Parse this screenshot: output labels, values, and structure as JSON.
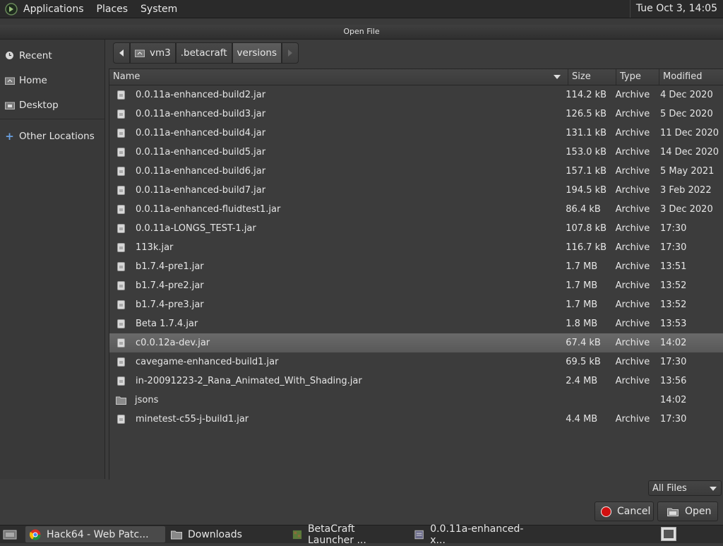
{
  "top_panel": {
    "menus": [
      "Applications",
      "Places",
      "System"
    ],
    "clock": "Tue Oct  3, 14:05"
  },
  "dialog": {
    "title": "Open File",
    "sidebar": {
      "items": [
        "Recent",
        "Home",
        "Desktop"
      ],
      "other": "Other Locations"
    },
    "pathbar": [
      "vm3",
      ".betacraft",
      "versions"
    ],
    "columns": {
      "name": "Name",
      "size": "Size",
      "type": "Type",
      "modified": "Modified"
    },
    "files": [
      {
        "name": "0.0.11a-enhanced-build2.jar",
        "size": "114.2 kB",
        "type": "Archive",
        "modified": "4 Dec 2020"
      },
      {
        "name": "0.0.11a-enhanced-build3.jar",
        "size": "126.5 kB",
        "type": "Archive",
        "modified": "5 Dec 2020"
      },
      {
        "name": "0.0.11a-enhanced-build4.jar",
        "size": "131.1 kB",
        "type": "Archive",
        "modified": "11 Dec 2020"
      },
      {
        "name": "0.0.11a-enhanced-build5.jar",
        "size": "153.0 kB",
        "type": "Archive",
        "modified": "14 Dec 2020"
      },
      {
        "name": "0.0.11a-enhanced-build6.jar",
        "size": "157.1 kB",
        "type": "Archive",
        "modified": "5 May 2021"
      },
      {
        "name": "0.0.11a-enhanced-build7.jar",
        "size": "194.5 kB",
        "type": "Archive",
        "modified": "3 Feb 2022"
      },
      {
        "name": "0.0.11a-enhanced-fluidtest1.jar",
        "size": "86.4 kB",
        "type": "Archive",
        "modified": "3 Dec 2020"
      },
      {
        "name": "0.0.11a-LONGS_TEST-1.jar",
        "size": "107.8 kB",
        "type": "Archive",
        "modified": "17:30"
      },
      {
        "name": "113k.jar",
        "size": "116.7 kB",
        "type": "Archive",
        "modified": "17:30"
      },
      {
        "name": "b1.7.4-pre1.jar",
        "size": "1.7 MB",
        "type": "Archive",
        "modified": "13:51"
      },
      {
        "name": "b1.7.4-pre2.jar",
        "size": "1.7 MB",
        "type": "Archive",
        "modified": "13:52"
      },
      {
        "name": "b1.7.4-pre3.jar",
        "size": "1.7 MB",
        "type": "Archive",
        "modified": "13:52"
      },
      {
        "name": "Beta 1.7.4.jar",
        "size": "1.8 MB",
        "type": "Archive",
        "modified": "13:53"
      },
      {
        "name": "c0.0.12a-dev.jar",
        "size": "67.4 kB",
        "type": "Archive",
        "modified": "14:02",
        "selected": true
      },
      {
        "name": "cavegame-enhanced-build1.jar",
        "size": "69.5 kB",
        "type": "Archive",
        "modified": "17:30"
      },
      {
        "name": "in-20091223-2_Rana_Animated_With_Shading.jar",
        "size": "2.4 MB",
        "type": "Archive",
        "modified": "13:56"
      },
      {
        "name": "jsons",
        "size": "",
        "type": "",
        "modified": "14:02",
        "folder": true
      },
      {
        "name": "minetest-c55-j-build1.jar",
        "size": "4.4 MB",
        "type": "Archive",
        "modified": "17:30"
      }
    ],
    "filter": "All Files",
    "cancel_label": "Cancel",
    "open_label": "Open"
  },
  "taskbar": {
    "tasks": [
      "Hack64 - Web Patc...",
      "Downloads",
      "BetaCraft Launcher ...",
      "0.0.11a-enhanced-x..."
    ]
  },
  "colors": {
    "panel": "#2a2a2a",
    "dialog": "#3c3c3c",
    "selection": "#606060",
    "cancel_red": "#d01010"
  }
}
